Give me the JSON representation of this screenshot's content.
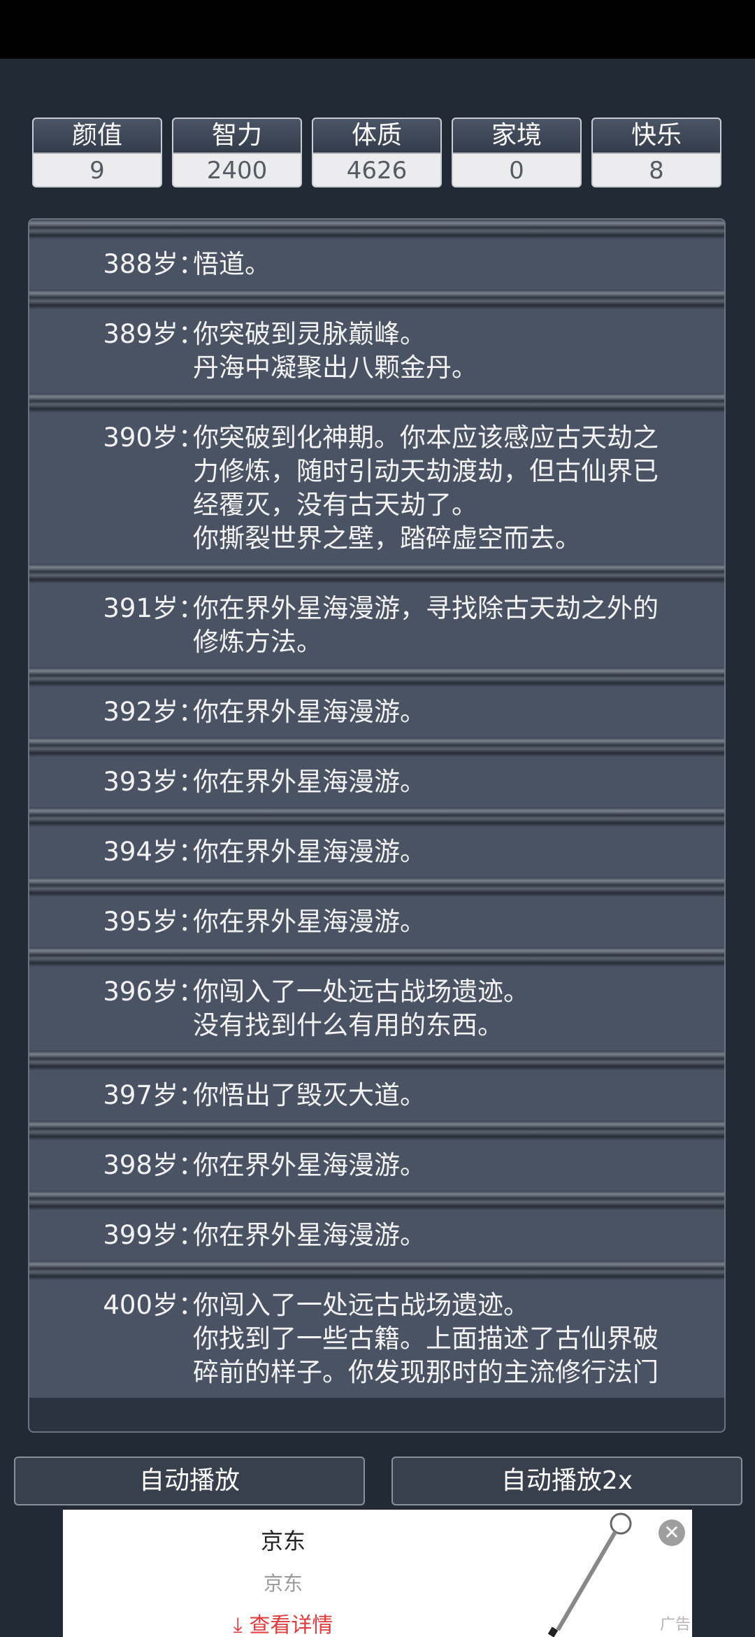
{
  "stats": [
    {
      "label": "颜值",
      "value": "9"
    },
    {
      "label": "智力",
      "value": "2400"
    },
    {
      "label": "体质",
      "value": "4626"
    },
    {
      "label": "家境",
      "value": "0"
    },
    {
      "label": "快乐",
      "value": "8"
    }
  ],
  "log": [
    {
      "age": "388岁：",
      "lines": [
        "悟道。"
      ]
    },
    {
      "age": "389岁：",
      "lines": [
        "你突破到灵脉巅峰。",
        "丹海中凝聚出八颗金丹。"
      ]
    },
    {
      "age": "390岁：",
      "lines": [
        "你突破到化神期。你本应该感应古天劫之",
        "力修炼，随时引动天劫渡劫，但古仙界已",
        "经覆灭，没有古天劫了。",
        "你撕裂世界之壁，踏碎虚空而去。"
      ]
    },
    {
      "age": "391岁：",
      "lines": [
        "你在界外星海漫游，寻找除古天劫之外的",
        "修炼方法。"
      ]
    },
    {
      "age": "392岁：",
      "lines": [
        "你在界外星海漫游。"
      ]
    },
    {
      "age": "393岁：",
      "lines": [
        "你在界外星海漫游。"
      ]
    },
    {
      "age": "394岁：",
      "lines": [
        "你在界外星海漫游。"
      ]
    },
    {
      "age": "395岁：",
      "lines": [
        "你在界外星海漫游。"
      ]
    },
    {
      "age": "396岁：",
      "lines": [
        "你闯入了一处远古战场遗迹。",
        "没有找到什么有用的东西。"
      ]
    },
    {
      "age": "397岁：",
      "lines": [
        "你悟出了毁灭大道。"
      ]
    },
    {
      "age": "398岁：",
      "lines": [
        "你在界外星海漫游。"
      ]
    },
    {
      "age": "399岁：",
      "lines": [
        "你在界外星海漫游。"
      ]
    },
    {
      "age": "400岁：",
      "lines": [
        "你闯入了一处远古战场遗迹。",
        "你找到了一些古籍。上面描述了古仙界破",
        "碎前的样子。你发现那时的主流修行法门"
      ]
    }
  ],
  "buttons": {
    "auto_play": "自动播放",
    "auto_play_2x": "自动播放2x"
  },
  "ad": {
    "title": "京东",
    "subtitle": "京东",
    "link": "查看详情",
    "tag": "广告",
    "close_icon": "close-icon",
    "download_icon": "download-arrow-icon"
  }
}
